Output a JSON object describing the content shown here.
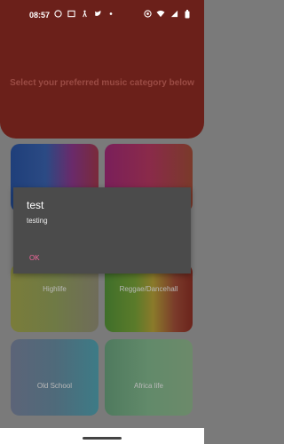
{
  "status_bar": {
    "time": "08:57",
    "left_icons": [
      "whatsapp-icon",
      "image-icon",
      "accessibility-icon",
      "twitter-icon",
      "dot-icon"
    ],
    "right_icons": [
      "eye-icon",
      "wifi-icon",
      "signal-icon",
      "battery-icon"
    ]
  },
  "header": {
    "prompt": "Select your preferred music category below",
    "background": "#6b201a"
  },
  "categories": [
    {
      "label": ""
    },
    {
      "label": ""
    },
    {
      "label": "Highlife"
    },
    {
      "label": "Reggae/Dancehall"
    },
    {
      "label": "Old School"
    },
    {
      "label": "Africa life"
    }
  ],
  "dialog": {
    "title": "test",
    "message": "testing",
    "ok_label": "OK",
    "ok_color": "#f0679a"
  }
}
